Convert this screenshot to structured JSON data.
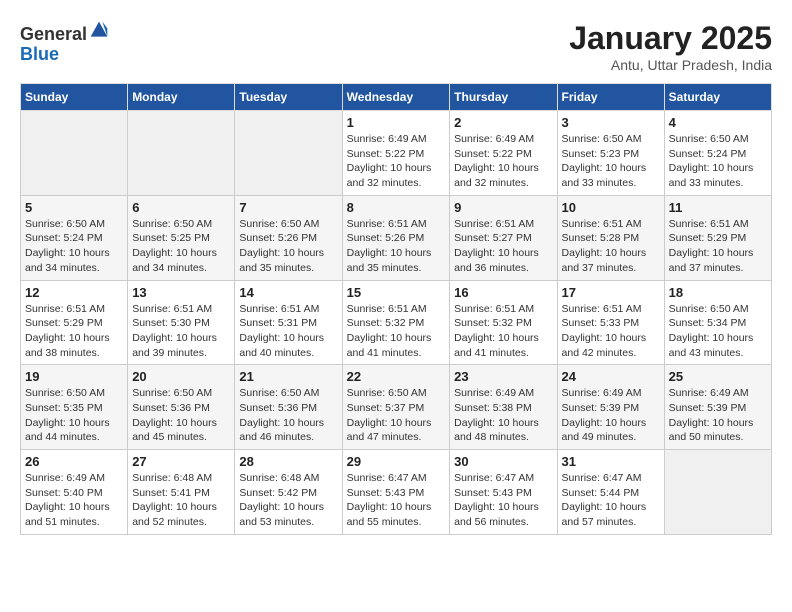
{
  "header": {
    "logo_line1": "General",
    "logo_line2": "Blue",
    "month_title": "January 2025",
    "location": "Antu, Uttar Pradesh, India"
  },
  "days_of_week": [
    "Sunday",
    "Monday",
    "Tuesday",
    "Wednesday",
    "Thursday",
    "Friday",
    "Saturday"
  ],
  "weeks": [
    [
      {
        "day": "",
        "info": ""
      },
      {
        "day": "",
        "info": ""
      },
      {
        "day": "",
        "info": ""
      },
      {
        "day": "1",
        "info": "Sunrise: 6:49 AM\nSunset: 5:22 PM\nDaylight: 10 hours\nand 32 minutes."
      },
      {
        "day": "2",
        "info": "Sunrise: 6:49 AM\nSunset: 5:22 PM\nDaylight: 10 hours\nand 32 minutes."
      },
      {
        "day": "3",
        "info": "Sunrise: 6:50 AM\nSunset: 5:23 PM\nDaylight: 10 hours\nand 33 minutes."
      },
      {
        "day": "4",
        "info": "Sunrise: 6:50 AM\nSunset: 5:24 PM\nDaylight: 10 hours\nand 33 minutes."
      }
    ],
    [
      {
        "day": "5",
        "info": "Sunrise: 6:50 AM\nSunset: 5:24 PM\nDaylight: 10 hours\nand 34 minutes."
      },
      {
        "day": "6",
        "info": "Sunrise: 6:50 AM\nSunset: 5:25 PM\nDaylight: 10 hours\nand 34 minutes."
      },
      {
        "day": "7",
        "info": "Sunrise: 6:50 AM\nSunset: 5:26 PM\nDaylight: 10 hours\nand 35 minutes."
      },
      {
        "day": "8",
        "info": "Sunrise: 6:51 AM\nSunset: 5:26 PM\nDaylight: 10 hours\nand 35 minutes."
      },
      {
        "day": "9",
        "info": "Sunrise: 6:51 AM\nSunset: 5:27 PM\nDaylight: 10 hours\nand 36 minutes."
      },
      {
        "day": "10",
        "info": "Sunrise: 6:51 AM\nSunset: 5:28 PM\nDaylight: 10 hours\nand 37 minutes."
      },
      {
        "day": "11",
        "info": "Sunrise: 6:51 AM\nSunset: 5:29 PM\nDaylight: 10 hours\nand 37 minutes."
      }
    ],
    [
      {
        "day": "12",
        "info": "Sunrise: 6:51 AM\nSunset: 5:29 PM\nDaylight: 10 hours\nand 38 minutes."
      },
      {
        "day": "13",
        "info": "Sunrise: 6:51 AM\nSunset: 5:30 PM\nDaylight: 10 hours\nand 39 minutes."
      },
      {
        "day": "14",
        "info": "Sunrise: 6:51 AM\nSunset: 5:31 PM\nDaylight: 10 hours\nand 40 minutes."
      },
      {
        "day": "15",
        "info": "Sunrise: 6:51 AM\nSunset: 5:32 PM\nDaylight: 10 hours\nand 41 minutes."
      },
      {
        "day": "16",
        "info": "Sunrise: 6:51 AM\nSunset: 5:32 PM\nDaylight: 10 hours\nand 41 minutes."
      },
      {
        "day": "17",
        "info": "Sunrise: 6:51 AM\nSunset: 5:33 PM\nDaylight: 10 hours\nand 42 minutes."
      },
      {
        "day": "18",
        "info": "Sunrise: 6:50 AM\nSunset: 5:34 PM\nDaylight: 10 hours\nand 43 minutes."
      }
    ],
    [
      {
        "day": "19",
        "info": "Sunrise: 6:50 AM\nSunset: 5:35 PM\nDaylight: 10 hours\nand 44 minutes."
      },
      {
        "day": "20",
        "info": "Sunrise: 6:50 AM\nSunset: 5:36 PM\nDaylight: 10 hours\nand 45 minutes."
      },
      {
        "day": "21",
        "info": "Sunrise: 6:50 AM\nSunset: 5:36 PM\nDaylight: 10 hours\nand 46 minutes."
      },
      {
        "day": "22",
        "info": "Sunrise: 6:50 AM\nSunset: 5:37 PM\nDaylight: 10 hours\nand 47 minutes."
      },
      {
        "day": "23",
        "info": "Sunrise: 6:49 AM\nSunset: 5:38 PM\nDaylight: 10 hours\nand 48 minutes."
      },
      {
        "day": "24",
        "info": "Sunrise: 6:49 AM\nSunset: 5:39 PM\nDaylight: 10 hours\nand 49 minutes."
      },
      {
        "day": "25",
        "info": "Sunrise: 6:49 AM\nSunset: 5:39 PM\nDaylight: 10 hours\nand 50 minutes."
      }
    ],
    [
      {
        "day": "26",
        "info": "Sunrise: 6:49 AM\nSunset: 5:40 PM\nDaylight: 10 hours\nand 51 minutes."
      },
      {
        "day": "27",
        "info": "Sunrise: 6:48 AM\nSunset: 5:41 PM\nDaylight: 10 hours\nand 52 minutes."
      },
      {
        "day": "28",
        "info": "Sunrise: 6:48 AM\nSunset: 5:42 PM\nDaylight: 10 hours\nand 53 minutes."
      },
      {
        "day": "29",
        "info": "Sunrise: 6:47 AM\nSunset: 5:43 PM\nDaylight: 10 hours\nand 55 minutes."
      },
      {
        "day": "30",
        "info": "Sunrise: 6:47 AM\nSunset: 5:43 PM\nDaylight: 10 hours\nand 56 minutes."
      },
      {
        "day": "31",
        "info": "Sunrise: 6:47 AM\nSunset: 5:44 PM\nDaylight: 10 hours\nand 57 minutes."
      },
      {
        "day": "",
        "info": ""
      }
    ]
  ]
}
